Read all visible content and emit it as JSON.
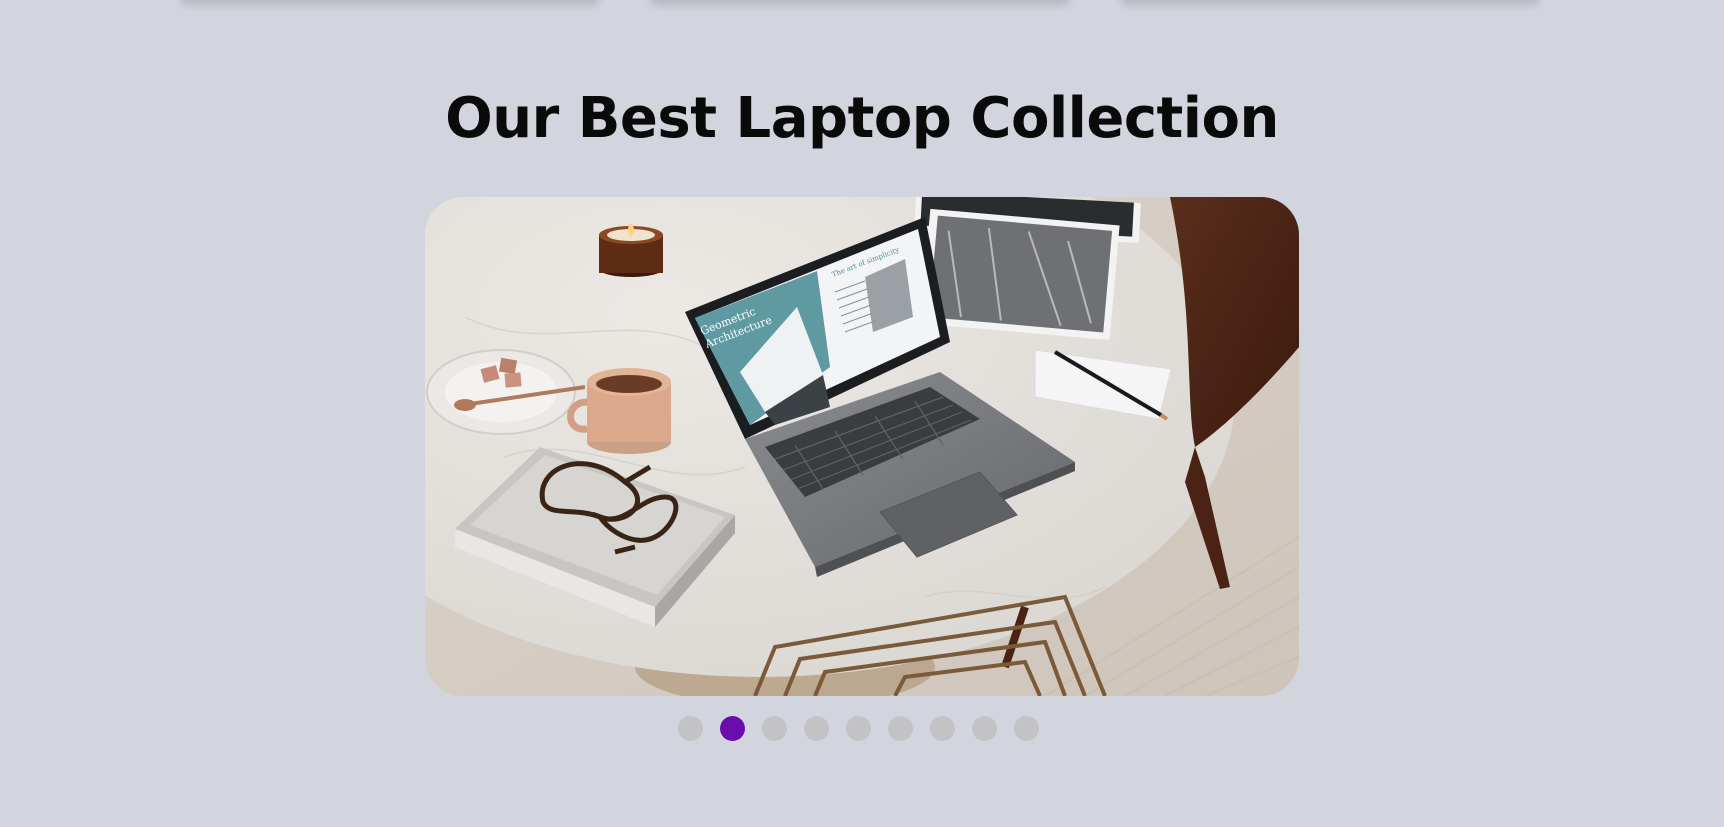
{
  "section": {
    "title": "Our Best Laptop Collection"
  },
  "carousel": {
    "slide_count": 9,
    "active_index": 1,
    "screen_text": {
      "doc_title_line1": "Geometric",
      "doc_title_line2": "Architecture",
      "side_heading": "The art of simplicity"
    }
  },
  "colors": {
    "accent": "#6a0dad",
    "dot_inactive": "#c3c3c5",
    "background": "#d2d5de"
  }
}
